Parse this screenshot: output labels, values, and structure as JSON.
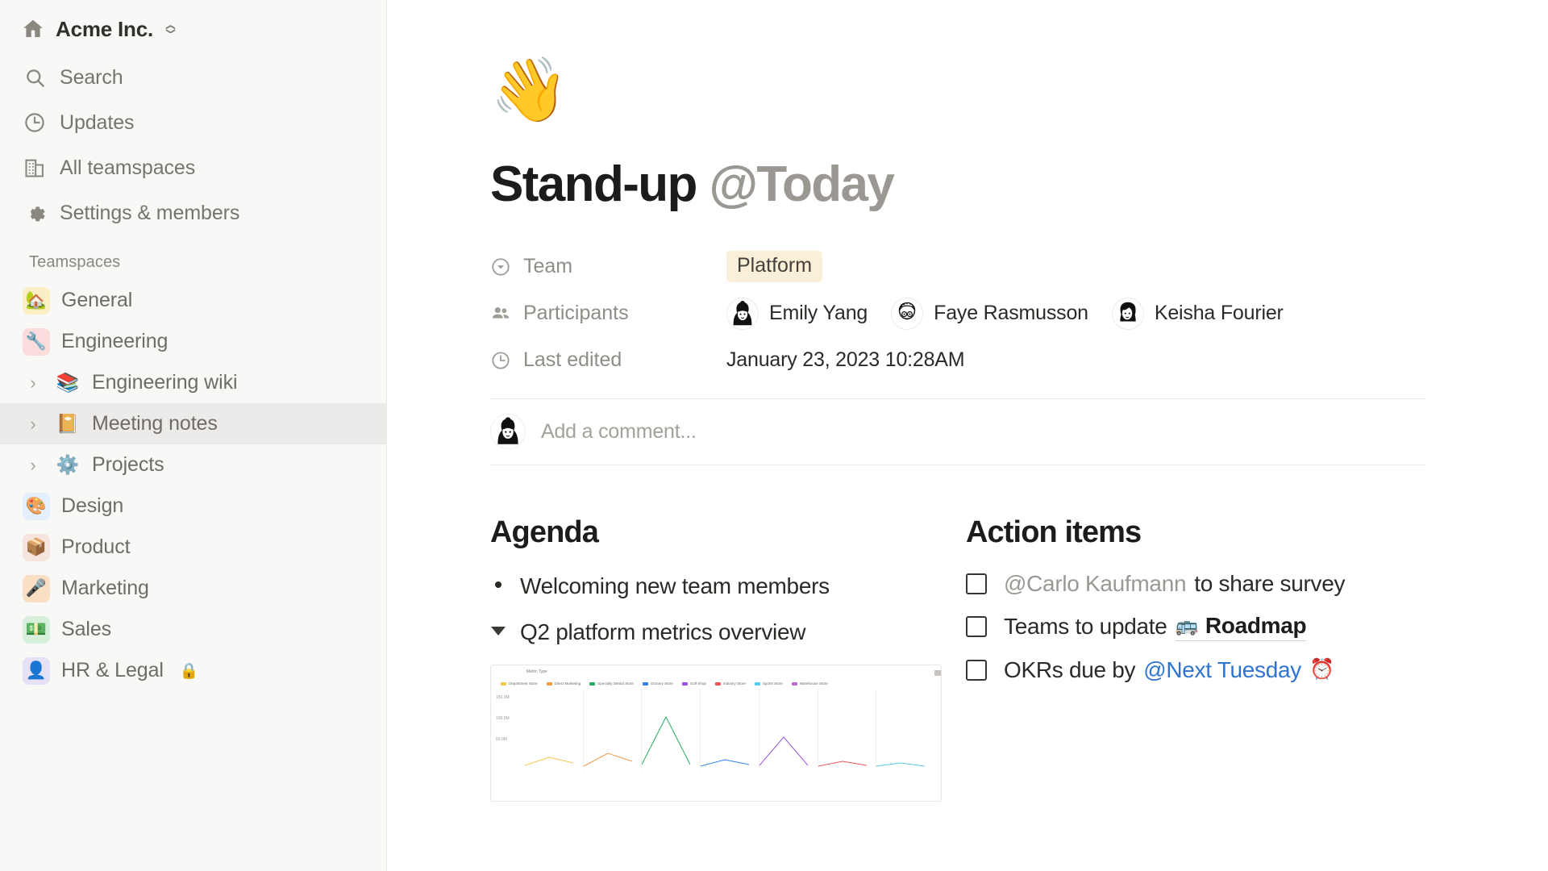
{
  "sidebar": {
    "workspace": {
      "name": "Acme Inc.",
      "icon": "house-icon"
    },
    "nav": [
      {
        "label": "Search",
        "icon": "search-icon"
      },
      {
        "label": "Updates",
        "icon": "clock-icon"
      },
      {
        "label": "All teamspaces",
        "icon": "buildings-icon"
      },
      {
        "label": "Settings & members",
        "icon": "gear-icon"
      }
    ],
    "section_label": "Teamspaces",
    "teamspaces": [
      {
        "label": "General",
        "emoji": "🏡",
        "bg": "#fbeec4",
        "type": "space",
        "selected": false,
        "caret": false
      },
      {
        "label": "Engineering",
        "emoji": "🔧",
        "bg": "#fcdcdc",
        "type": "space",
        "selected": false,
        "caret": false
      },
      {
        "label": "Engineering wiki",
        "emoji": "📚",
        "bg": "",
        "type": "page",
        "selected": false,
        "caret": true
      },
      {
        "label": "Meeting notes",
        "emoji": "📔",
        "bg": "",
        "type": "page",
        "selected": true,
        "caret": true
      },
      {
        "label": "Projects",
        "emoji": "⚙️",
        "bg": "",
        "type": "page",
        "selected": false,
        "caret": true
      },
      {
        "label": "Design",
        "emoji": "🎨",
        "bg": "#e3f0fb",
        "type": "space",
        "selected": false,
        "caret": false
      },
      {
        "label": "Product",
        "emoji": "📦",
        "bg": "#f6e4de",
        "type": "space",
        "selected": false,
        "caret": false
      },
      {
        "label": "Marketing",
        "emoji": "🎤",
        "bg": "#fadfc2",
        "type": "space",
        "selected": false,
        "caret": false
      },
      {
        "label": "Sales",
        "emoji": "💵",
        "bg": "#d6f0dc",
        "type": "space",
        "selected": false,
        "caret": false
      },
      {
        "label": "HR & Legal",
        "emoji": "👤",
        "bg": "#e6e1f5",
        "type": "space",
        "selected": false,
        "caret": false,
        "locked": true,
        "lock_emoji": "🔒"
      }
    ]
  },
  "page": {
    "emoji": "👋",
    "title_main": "Stand-up",
    "title_mention": "@Today",
    "properties": [
      {
        "key": "Team",
        "icon": "select-icon"
      },
      {
        "key": "Participants",
        "icon": "people-icon"
      },
      {
        "key": "Last edited",
        "icon": "clock-icon"
      }
    ],
    "team_tag": "Platform",
    "participants": [
      {
        "name": "Emily Yang",
        "avatar": "avatar-emily"
      },
      {
        "name": "Faye Rasmusson",
        "avatar": "avatar-faye"
      },
      {
        "name": "Keisha Fourier",
        "avatar": "avatar-keisha"
      }
    ],
    "last_edited": "January 23, 2023 10:28AM",
    "comment": {
      "placeholder": "Add a comment...",
      "avatar": "avatar-emily"
    }
  },
  "columns": {
    "agenda": {
      "heading": "Agenda",
      "items": [
        {
          "text": "Welcoming new team members",
          "bullet": "dot"
        },
        {
          "text": "Q2 platform metrics overview",
          "bullet": "toggle"
        }
      ]
    },
    "action_items": {
      "heading": "Action items",
      "items": [
        {
          "checked": false,
          "mention": "@Carlo Kaufmann",
          "text": "to share survey"
        },
        {
          "checked": false,
          "text": "Teams to update",
          "link": "Roadmap",
          "link_emoji": "🚌"
        },
        {
          "checked": false,
          "text": "OKRs due by",
          "date_mention": "@Next Tuesday",
          "trailing_emoji": "⏰"
        }
      ]
    }
  },
  "chart_data": {
    "type": "line",
    "title": "Metric Type",
    "legend": [
      {
        "name": "Department Store",
        "color": "#f2c94c"
      },
      {
        "name": "Direct Marketing",
        "color": "#f2994a"
      },
      {
        "name": "Specialty Dental Store",
        "color": "#27ae60"
      },
      {
        "name": "Grocery Store",
        "color": "#2f80ed"
      },
      {
        "name": "Golf Shop",
        "color": "#9b51e0"
      },
      {
        "name": "Industry Store",
        "color": "#eb5757"
      },
      {
        "name": "Sports Store",
        "color": "#56ccf2"
      },
      {
        "name": "Warehouse Store",
        "color": "#bb6bd9"
      }
    ],
    "ylabel_ticks": [
      "150.0M",
      "100.0M",
      "50.0M"
    ],
    "panels": 7,
    "grid": true
  }
}
